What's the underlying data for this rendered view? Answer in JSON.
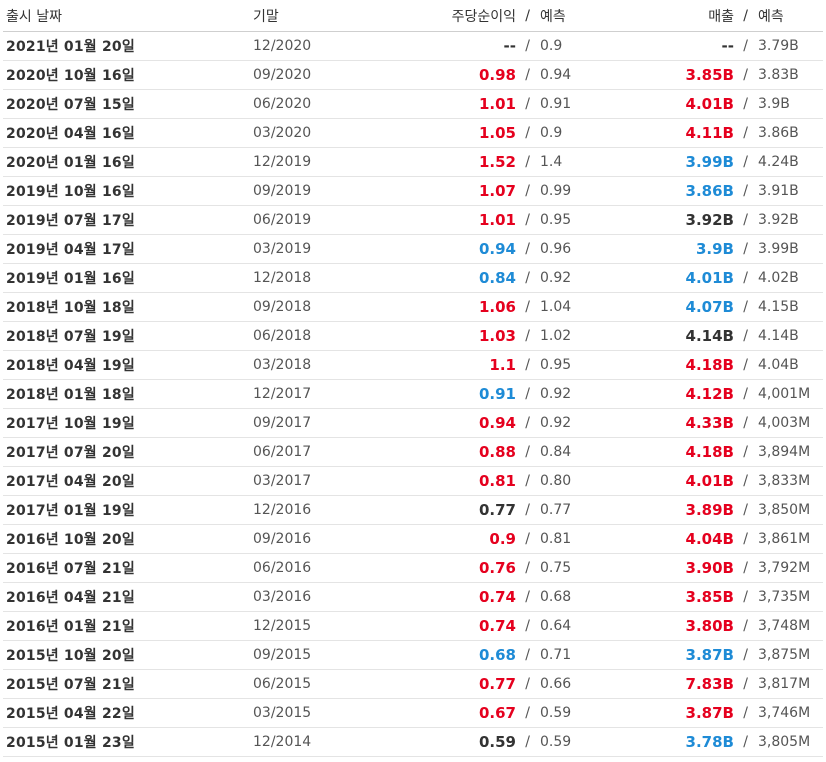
{
  "header": {
    "date": "출시 날짜",
    "period": "기말",
    "eps": "주당순이익",
    "eps_sep": "/",
    "eps_forecast": "예측",
    "revenue": "매출",
    "revenue_sep": "/",
    "revenue_forecast": "예측"
  },
  "colors": {
    "up": "#e5001e",
    "down": "#1e8bd6",
    "flat": "#333333"
  },
  "rows": [
    {
      "date": "2021년 01월 20일",
      "period": "12/2020",
      "eps": "--",
      "eps_status": "flat",
      "eps_forecast": "0.9",
      "revenue": "--",
      "revenue_status": "flat",
      "revenue_forecast": "3.79B"
    },
    {
      "date": "2020년 10월 16일",
      "period": "09/2020",
      "eps": "0.98",
      "eps_status": "up",
      "eps_forecast": "0.94",
      "revenue": "3.85B",
      "revenue_status": "up",
      "revenue_forecast": "3.83B"
    },
    {
      "date": "2020년 07월 15일",
      "period": "06/2020",
      "eps": "1.01",
      "eps_status": "up",
      "eps_forecast": "0.91",
      "revenue": "4.01B",
      "revenue_status": "up",
      "revenue_forecast": "3.9B"
    },
    {
      "date": "2020년 04월 16일",
      "period": "03/2020",
      "eps": "1.05",
      "eps_status": "up",
      "eps_forecast": "0.9",
      "revenue": "4.11B",
      "revenue_status": "up",
      "revenue_forecast": "3.86B"
    },
    {
      "date": "2020년 01월 16일",
      "period": "12/2019",
      "eps": "1.52",
      "eps_status": "up",
      "eps_forecast": "1.4",
      "revenue": "3.99B",
      "revenue_status": "down",
      "revenue_forecast": "4.24B"
    },
    {
      "date": "2019년 10월 16일",
      "period": "09/2019",
      "eps": "1.07",
      "eps_status": "up",
      "eps_forecast": "0.99",
      "revenue": "3.86B",
      "revenue_status": "down",
      "revenue_forecast": "3.91B"
    },
    {
      "date": "2019년 07월 17일",
      "period": "06/2019",
      "eps": "1.01",
      "eps_status": "up",
      "eps_forecast": "0.95",
      "revenue": "3.92B",
      "revenue_status": "flat",
      "revenue_forecast": "3.92B"
    },
    {
      "date": "2019년 04월 17일",
      "period": "03/2019",
      "eps": "0.94",
      "eps_status": "down",
      "eps_forecast": "0.96",
      "revenue": "3.9B",
      "revenue_status": "down",
      "revenue_forecast": "3.99B"
    },
    {
      "date": "2019년 01월 16일",
      "period": "12/2018",
      "eps": "0.84",
      "eps_status": "down",
      "eps_forecast": "0.92",
      "revenue": "4.01B",
      "revenue_status": "down",
      "revenue_forecast": "4.02B"
    },
    {
      "date": "2018년 10월 18일",
      "period": "09/2018",
      "eps": "1.06",
      "eps_status": "up",
      "eps_forecast": "1.04",
      "revenue": "4.07B",
      "revenue_status": "down",
      "revenue_forecast": "4.15B"
    },
    {
      "date": "2018년 07월 19일",
      "period": "06/2018",
      "eps": "1.03",
      "eps_status": "up",
      "eps_forecast": "1.02",
      "revenue": "4.14B",
      "revenue_status": "flat",
      "revenue_forecast": "4.14B"
    },
    {
      "date": "2018년 04월 19일",
      "period": "03/2018",
      "eps": "1.1",
      "eps_status": "up",
      "eps_forecast": "0.95",
      "revenue": "4.18B",
      "revenue_status": "up",
      "revenue_forecast": "4.04B"
    },
    {
      "date": "2018년 01월 18일",
      "period": "12/2017",
      "eps": "0.91",
      "eps_status": "down",
      "eps_forecast": "0.92",
      "revenue": "4.12B",
      "revenue_status": "up",
      "revenue_forecast": "4,001M"
    },
    {
      "date": "2017년 10월 19일",
      "period": "09/2017",
      "eps": "0.94",
      "eps_status": "up",
      "eps_forecast": "0.92",
      "revenue": "4.33B",
      "revenue_status": "up",
      "revenue_forecast": "4,003M"
    },
    {
      "date": "2017년 07월 20일",
      "period": "06/2017",
      "eps": "0.88",
      "eps_status": "up",
      "eps_forecast": "0.84",
      "revenue": "4.18B",
      "revenue_status": "up",
      "revenue_forecast": "3,894M"
    },
    {
      "date": "2017년 04월 20일",
      "period": "03/2017",
      "eps": "0.81",
      "eps_status": "up",
      "eps_forecast": "0.80",
      "revenue": "4.01B",
      "revenue_status": "up",
      "revenue_forecast": "3,833M"
    },
    {
      "date": "2017년 01월 19일",
      "period": "12/2016",
      "eps": "0.77",
      "eps_status": "flat",
      "eps_forecast": "0.77",
      "revenue": "3.89B",
      "revenue_status": "up",
      "revenue_forecast": "3,850M"
    },
    {
      "date": "2016년 10월 20일",
      "period": "09/2016",
      "eps": "0.9",
      "eps_status": "up",
      "eps_forecast": "0.81",
      "revenue": "4.04B",
      "revenue_status": "up",
      "revenue_forecast": "3,861M"
    },
    {
      "date": "2016년 07월 21일",
      "period": "06/2016",
      "eps": "0.76",
      "eps_status": "up",
      "eps_forecast": "0.75",
      "revenue": "3.90B",
      "revenue_status": "up",
      "revenue_forecast": "3,792M"
    },
    {
      "date": "2016년 04월 21일",
      "period": "03/2016",
      "eps": "0.74",
      "eps_status": "up",
      "eps_forecast": "0.68",
      "revenue": "3.85B",
      "revenue_status": "up",
      "revenue_forecast": "3,735M"
    },
    {
      "date": "2016년 01월 21일",
      "period": "12/2015",
      "eps": "0.74",
      "eps_status": "up",
      "eps_forecast": "0.64",
      "revenue": "3.80B",
      "revenue_status": "up",
      "revenue_forecast": "3,748M"
    },
    {
      "date": "2015년 10월 20일",
      "period": "09/2015",
      "eps": "0.68",
      "eps_status": "down",
      "eps_forecast": "0.71",
      "revenue": "3.87B",
      "revenue_status": "down",
      "revenue_forecast": "3,875M"
    },
    {
      "date": "2015년 07월 21일",
      "period": "06/2015",
      "eps": "0.77",
      "eps_status": "up",
      "eps_forecast": "0.66",
      "revenue": "7.83B",
      "revenue_status": "up",
      "revenue_forecast": "3,817M"
    },
    {
      "date": "2015년 04월 22일",
      "period": "03/2015",
      "eps": "0.67",
      "eps_status": "up",
      "eps_forecast": "0.59",
      "revenue": "3.87B",
      "revenue_status": "up",
      "revenue_forecast": "3,746M"
    },
    {
      "date": "2015년 01월 23일",
      "period": "12/2014",
      "eps": "0.59",
      "eps_status": "flat",
      "eps_forecast": "0.59",
      "revenue": "3.78B",
      "revenue_status": "down",
      "revenue_forecast": "3,805M"
    }
  ]
}
